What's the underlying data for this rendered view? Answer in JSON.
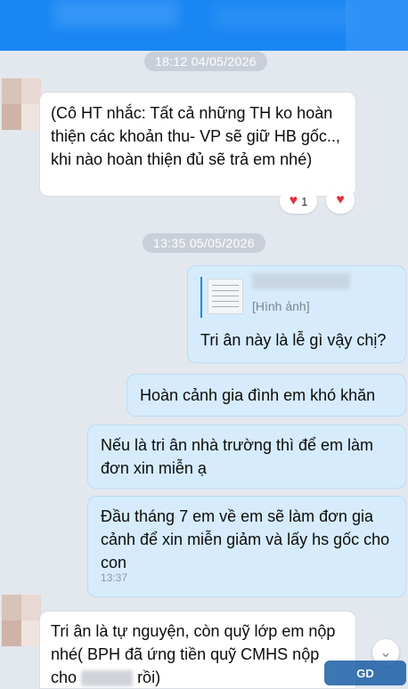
{
  "timestamps": [
    "18:12 04/05/2026",
    "13:35 05/05/2026"
  ],
  "messages": {
    "m1": "(Cô HT nhắc: Tất cả những TH ko hoàn thiện các khoản thu- VP sẽ giữ HB gốc.., khi nào hoàn thiện đủ sẽ trả em nhé)",
    "m1_reaction_count": "1",
    "quote_label": "[Hình ảnh]",
    "m2": "Tri ân này là lễ gì vậy chị?",
    "m3": "Hoàn cảnh gia đình em khó khăn",
    "m4": "Nếu là tri ân nhà trường thì để em làm đơn xin miễn ạ",
    "m5": "Đầu tháng 7 em về em sẽ làm đơn gia cảnh để xin miễn giảm và lấy hs gốc cho con",
    "m5_time": "13:37",
    "m6_part1": "Tri ân là tự nguyện, còn quỹ lớp em nộp nhé( BPH đã ứng tiền quỹ CMHS nộp cho",
    "m6_part2": "rồi)"
  },
  "icons": {
    "reaction": "heart-icon",
    "scroll": "chevron-down-icon"
  },
  "colors": {
    "header": "#1a86f3",
    "incoming": "#ffffff",
    "outgoing": "#d6ecfc",
    "heart": "#e5303c"
  }
}
